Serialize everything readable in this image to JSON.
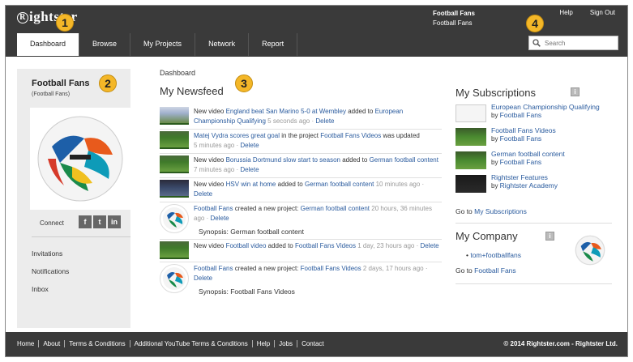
{
  "header": {
    "logo_text": "ightster",
    "logo_mark": "R",
    "user_name": "Football Fans",
    "user_sub": "Football Fans",
    "help": "Help",
    "sign_out": "Sign Out",
    "search_placeholder": "Search"
  },
  "nav": {
    "tabs": [
      {
        "label": "Dashboard",
        "active": true
      },
      {
        "label": "Browse"
      },
      {
        "label": "My Projects"
      },
      {
        "label": "Network"
      },
      {
        "label": "Report"
      }
    ]
  },
  "callouts": [
    "1",
    "2",
    "3",
    "4"
  ],
  "sidebar": {
    "name": "Football Fans",
    "sub": "(Football Fans)",
    "connect": "Connect",
    "social": [
      "f",
      "t",
      "in"
    ],
    "links": [
      "Invitations",
      "Notifications",
      "Inbox"
    ]
  },
  "main": {
    "breadcrumb": "Dashboard",
    "title": "My Newsfeed",
    "items": [
      {
        "prefix": "New video ",
        "link1": "England beat San Marino 5-0 at Wembley",
        "mid": " added to ",
        "link2": "European Championship Qualifying",
        "time": "5 seconds ago",
        "delete": "Delete"
      },
      {
        "prefix": "",
        "link1": "Matej Vydra scores great goal",
        "mid": " in the project ",
        "link2": "Football Fans Videos",
        "suffix": " was updated",
        "time": "5 minutes ago",
        "delete": "Delete"
      },
      {
        "prefix": "New video ",
        "link1": "Borussia Dortmund slow start to season",
        "mid": " added to ",
        "link2": "German football content",
        "time": "7 minutes ago",
        "delete": "Delete"
      },
      {
        "prefix": "New video ",
        "link1": "HSV win at home",
        "mid": " added to ",
        "link2": "German football content",
        "time": "10 minutes ago",
        "delete": "Delete"
      },
      {
        "prefix": "",
        "link1": "Football Fans",
        "mid": " created a new project: ",
        "link2": "German football content",
        "time": "20 hours, 36 minutes ago",
        "delete": "Delete",
        "synopsis": "Synopsis: German football content"
      },
      {
        "prefix": "New video ",
        "link1": "Football video",
        "mid": " added to ",
        "link2": "Football Fans Videos",
        "time": "1 day, 23 hours ago",
        "delete": "Delete"
      },
      {
        "prefix": "",
        "link1": "Football Fans",
        "mid": " created a new project: ",
        "link2": "Football Fans Videos",
        "time": "2 days, 17 hours ago",
        "delete": "Delete",
        "synopsis": "Synopsis: Football Fans Videos"
      }
    ]
  },
  "subscriptions": {
    "title": "My Subscriptions",
    "items": [
      {
        "name": "European Championship Qualifying",
        "by": "by ",
        "owner": "Football Fans"
      },
      {
        "name": "Football Fans Videos",
        "by": "by ",
        "owner": "Football Fans"
      },
      {
        "name": "German football content",
        "by": "by ",
        "owner": "Football Fans"
      },
      {
        "name": "Rightster Features",
        "by": "by ",
        "owner": "Rightster Academy"
      }
    ],
    "goto_prefix": "Go to ",
    "goto_link": "My Subscriptions"
  },
  "company": {
    "title": "My Company",
    "members": [
      "tom+footballfans"
    ],
    "goto_prefix": "Go to ",
    "goto_link": "Football Fans"
  },
  "footer": {
    "links": [
      "Home",
      "About",
      "Terms & Conditions",
      "Additional YouTube Terms & Conditions",
      "Help",
      "Jobs",
      "Contact"
    ],
    "copyright": "© 2014 Rightster.com - Rightster Ltd."
  }
}
